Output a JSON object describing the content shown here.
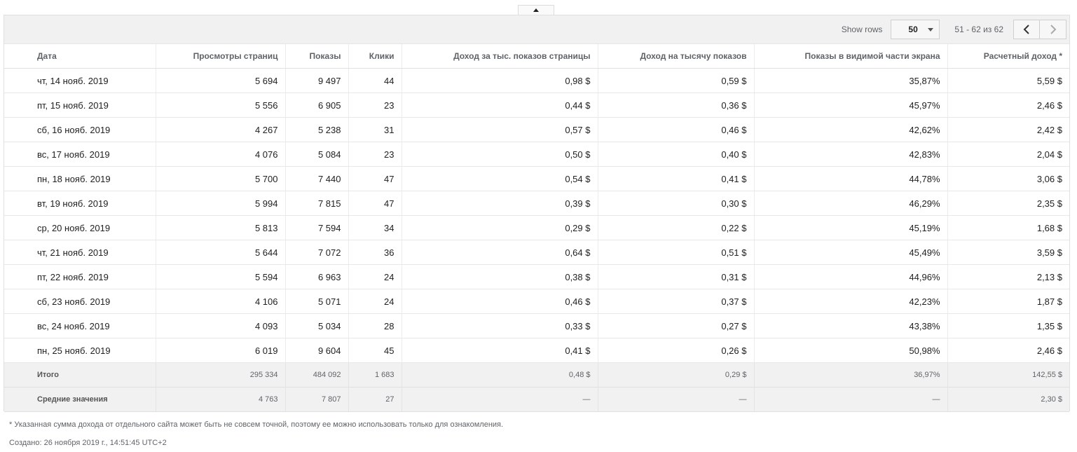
{
  "toolbar": {
    "show_rows_label": "Show rows",
    "rows_per_page": "50",
    "range": "51 - 62 из 62"
  },
  "icons": {
    "collapse": "caret-up-icon",
    "prev": "chevron-left-icon",
    "next": "chevron-right-icon",
    "dropdown": "triangle-down-icon"
  },
  "table": {
    "columns": [
      "Дата",
      "Просмотры страниц",
      "Показы",
      "Клики",
      "Доход за тыс. показов страницы",
      "Доход на тысячу показов",
      "Показы в видимой части экрана",
      "Расчетный доход *"
    ],
    "rows": [
      [
        "чт, 14 нояб. 2019",
        "5 694",
        "9 497",
        "44",
        "0,98 $",
        "0,59 $",
        "35,87%",
        "5,59 $"
      ],
      [
        "пт, 15 нояб. 2019",
        "5 556",
        "6 905",
        "23",
        "0,44 $",
        "0,36 $",
        "45,97%",
        "2,46 $"
      ],
      [
        "сб, 16 нояб. 2019",
        "4 267",
        "5 238",
        "31",
        "0,57 $",
        "0,46 $",
        "42,62%",
        "2,42 $"
      ],
      [
        "вс, 17 нояб. 2019",
        "4 076",
        "5 084",
        "23",
        "0,50 $",
        "0,40 $",
        "42,83%",
        "2,04 $"
      ],
      [
        "пн, 18 нояб. 2019",
        "5 700",
        "7 440",
        "47",
        "0,54 $",
        "0,41 $",
        "44,78%",
        "3,06 $"
      ],
      [
        "вт, 19 нояб. 2019",
        "5 994",
        "7 815",
        "47",
        "0,39 $",
        "0,30 $",
        "46,29%",
        "2,35 $"
      ],
      [
        "ср, 20 нояб. 2019",
        "5 813",
        "7 594",
        "34",
        "0,29 $",
        "0,22 $",
        "45,19%",
        "1,68 $"
      ],
      [
        "чт, 21 нояб. 2019",
        "5 644",
        "7 072",
        "36",
        "0,64 $",
        "0,51 $",
        "45,49%",
        "3,59 $"
      ],
      [
        "пт, 22 нояб. 2019",
        "5 594",
        "6 963",
        "24",
        "0,38 $",
        "0,31 $",
        "44,96%",
        "2,13 $"
      ],
      [
        "сб, 23 нояб. 2019",
        "4 106",
        "5 071",
        "24",
        "0,46 $",
        "0,37 $",
        "42,23%",
        "1,87 $"
      ],
      [
        "вс, 24 нояб. 2019",
        "4 093",
        "5 034",
        "28",
        "0,33 $",
        "0,27 $",
        "43,38%",
        "1,35 $"
      ],
      [
        "пн, 25 нояб. 2019",
        "6 019",
        "9 604",
        "45",
        "0,41 $",
        "0,26 $",
        "50,98%",
        "2,46 $"
      ]
    ],
    "totals": [
      "Итого",
      "295 334",
      "484 092",
      "1 683",
      "0,48 $",
      "0,29 $",
      "36,97%",
      "142,55 $"
    ],
    "averages": [
      "Средние значения",
      "4 763",
      "7 807",
      "27",
      "—",
      "—",
      "—",
      "2,30 $"
    ]
  },
  "footnote": "* Указанная сумма дохода от отдельного сайта может быть не совсем точной, поэтому ее можно использовать только для ознакомления.",
  "created": "Создано: 26 ноября 2019 г., 14:51:45 UTC+2"
}
